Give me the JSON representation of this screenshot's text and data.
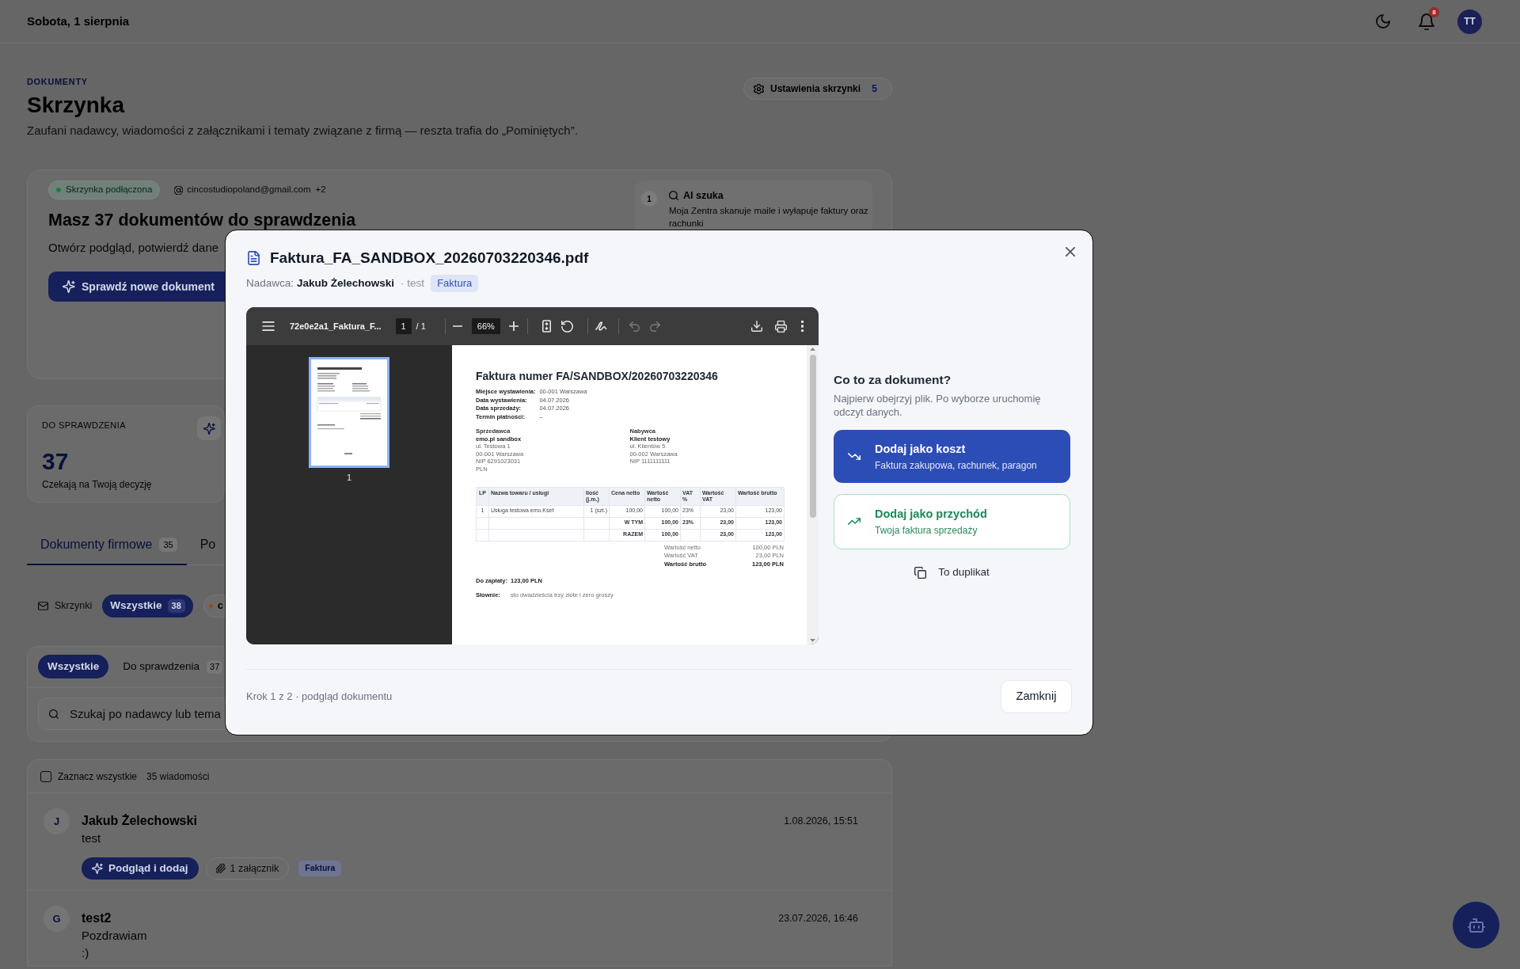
{
  "header": {
    "date": "Sobota, 1 sierpnia",
    "notification_count": "8",
    "avatar": "TT"
  },
  "page": {
    "eyebrow": "DOKUMENTY",
    "title": "Skrzynka",
    "subtitle": "Zaufani nadawcy, wiadomości z załącznikami i tematy związane z firmą — reszta trafia do „Pominiętych”.",
    "settings_button": {
      "label": "Ustawienia skrzynki",
      "count": "5"
    }
  },
  "hero": {
    "status": {
      "label": "Skrzynka podłączona",
      "color": "#1f7a45"
    },
    "email": "cincostudiopoland@gmail.com",
    "email_extra": "+2",
    "title": "Masz 37 dokumentów do sprawdzenia",
    "subtitle": "Otwórz podgląd, potwierdź dane",
    "button": "Sprawdź nowe dokument",
    "steps": [
      {
        "number": "1",
        "title": "AI szuka",
        "text": "Moja Zentra skanuje maile i wyłapuje faktury oraz rachunki"
      }
    ]
  },
  "stats": [
    {
      "label": "DO SPRAWDZENIA",
      "value": "37",
      "caption": "Czekają na Twoją decyzję"
    }
  ],
  "tabs": [
    {
      "label": "Dokumenty firmowe",
      "count": "35",
      "selected": true
    },
    {
      "label": "Po",
      "selected": false
    }
  ],
  "mailbox_filter": {
    "label": "Skrzynki",
    "chips": [
      {
        "label": "Wszystkie",
        "count": "38",
        "selected": true
      },
      {
        "label": "c",
        "color": "#9a4a12",
        "selected": false
      }
    ]
  },
  "status_filter": [
    {
      "label": "Wszystkie",
      "selected": true
    },
    {
      "label": "Do sprawdzenia",
      "count": "37",
      "selected": false
    }
  ],
  "search": {
    "placeholder": "Szukaj po nadawcy lub tema"
  },
  "list": {
    "select_all": {
      "label": "Zaznacz wszystkie",
      "checked": false
    },
    "count": "35 wiadomości",
    "messages": [
      {
        "avatar": "J",
        "sender": "Jakub Żelechowski",
        "lines": [
          "test"
        ],
        "date": "1.08.2026, 15:51",
        "action": "Podgląd i dodaj",
        "attachments": "1 załącznik",
        "tag": "Faktura"
      },
      {
        "avatar": "G",
        "sender": "test2",
        "lines": [
          "Pozdrawiam",
          ":)"
        ],
        "date": "23.07.2026, 16:46"
      }
    ]
  },
  "modal": {
    "title": "Faktura_FA_SANDBOX_20260703220346.pdf",
    "sender_label": "Nadawca:",
    "sender": "Jakub Żelechowski",
    "subject": "· test",
    "tag": "Faktura",
    "viewer": {
      "file_name": "72e0e2a1_Faktura_F...",
      "page": "1",
      "page_count": "/ 1",
      "zoom": "66%",
      "history": [
        {
          "kind": "undo",
          "disabled": true
        },
        {
          "kind": "redo",
          "disabled": true
        }
      ],
      "thumbnails": [
        {
          "label": "1",
          "selected": true
        }
      ],
      "document": {
        "title": "Faktura numer FA/SANDBOX/20260703220346",
        "details": [
          {
            "label": "Miejsce wystawienia:",
            "value": "00-001 Warszawa"
          },
          {
            "label": "Data wystawienia:",
            "value": "04.07.2026"
          },
          {
            "label": "Data sprzedaży:",
            "value": "04.07.2026"
          },
          {
            "label": "Termin płatności:",
            "value": "–"
          }
        ],
        "parties": [
          {
            "heading": "Sprzedawca",
            "name": "emo.pl sandbox",
            "lines": [
              "ul. Testowa 1",
              "00-001 Warszawa",
              "NIP 6291023031",
              "PLN"
            ]
          },
          {
            "heading": "Nabywca",
            "name": "Klient testowy",
            "lines": [
              "ul. Klientów 5",
              "00-002 Warszawa",
              "NIP 1111111111"
            ]
          }
        ],
        "table": {
          "columns": [
            "LP",
            "Nazwa towaru / usługi",
            "Ilość (j.m.)",
            "Cena netto",
            "Wartość netto",
            "VAT %",
            "Wartość VAT",
            "Wartość brutto"
          ],
          "items": [
            {
              "lp": "1",
              "name": "Usługa testowa emo.Ksef",
              "quantity": "1 (szt.)",
              "unit_net": "100,00",
              "net": "100,00",
              "vat_rate": "23%",
              "vat": "23,00",
              "gross": "123,00"
            }
          ],
          "summary": [
            {
              "label": "W TYM",
              "net": "100,00",
              "vat_rate": "23%",
              "vat": "23,00",
              "gross": "123,00"
            },
            {
              "label": "RAZEM",
              "net": "100,00",
              "vat": "23,00",
              "gross": "123,00"
            }
          ]
        },
        "totals": [
          {
            "label": "Wartość netto",
            "value": "100,00 PLN",
            "bold": false
          },
          {
            "label": "Wartość VAT",
            "value": "23,00 PLN",
            "bold": false
          },
          {
            "label": "Wartość brutto",
            "value": "123,00 PLN",
            "bold": true
          }
        ],
        "amount_due": {
          "label": "Do zapłaty:",
          "value": "123,00 PLN"
        },
        "in_words": {
          "label": "Słownie:",
          "value": "sto dwadzieścia trzy złote i zero groszy"
        }
      }
    },
    "prompt": {
      "title": "Co to za dokument?",
      "hint": "Najpierw obejrzyj plik. Po wyborze uruchomię odczyt danych."
    },
    "options": [
      {
        "kind": "cost",
        "title": "Dodaj jako koszt",
        "subtitle": "Faktura zakupowa, rachunek, paragon"
      },
      {
        "kind": "income",
        "title": "Dodaj jako przychód",
        "subtitle": "Twoja faktura sprzedaży"
      }
    ],
    "duplicate_button": "To duplikat",
    "step": "Krok 1 z 2 · podgląd dokumentu",
    "close_button": "Zamknij"
  }
}
